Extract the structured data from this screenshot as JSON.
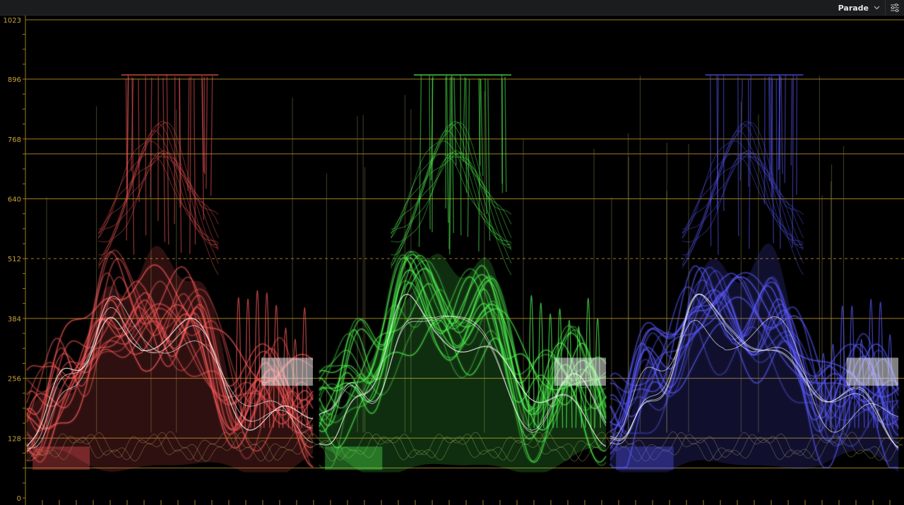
{
  "toolbar": {
    "mode_label": "Parade",
    "mode_icon": "chevron-down-icon",
    "settings_icon": "sliders-icon"
  },
  "scope": {
    "type": "rgb-parade-waveform",
    "axis_labels": [
      "1023",
      "896",
      "768",
      "640",
      "512",
      "384",
      "256",
      "128",
      "0"
    ],
    "axis_values": [
      1023,
      896,
      768,
      640,
      512,
      384,
      256,
      128,
      0
    ],
    "extra_guides": [
      736,
      64
    ],
    "dashed_guide": 512,
    "colors": {
      "grid": "#a07c1f",
      "label": "#c7a43c",
      "red": "#ff5a5a",
      "green": "#55ff55",
      "blue": "#5a5aff",
      "trace": "#b8ae62"
    }
  }
}
